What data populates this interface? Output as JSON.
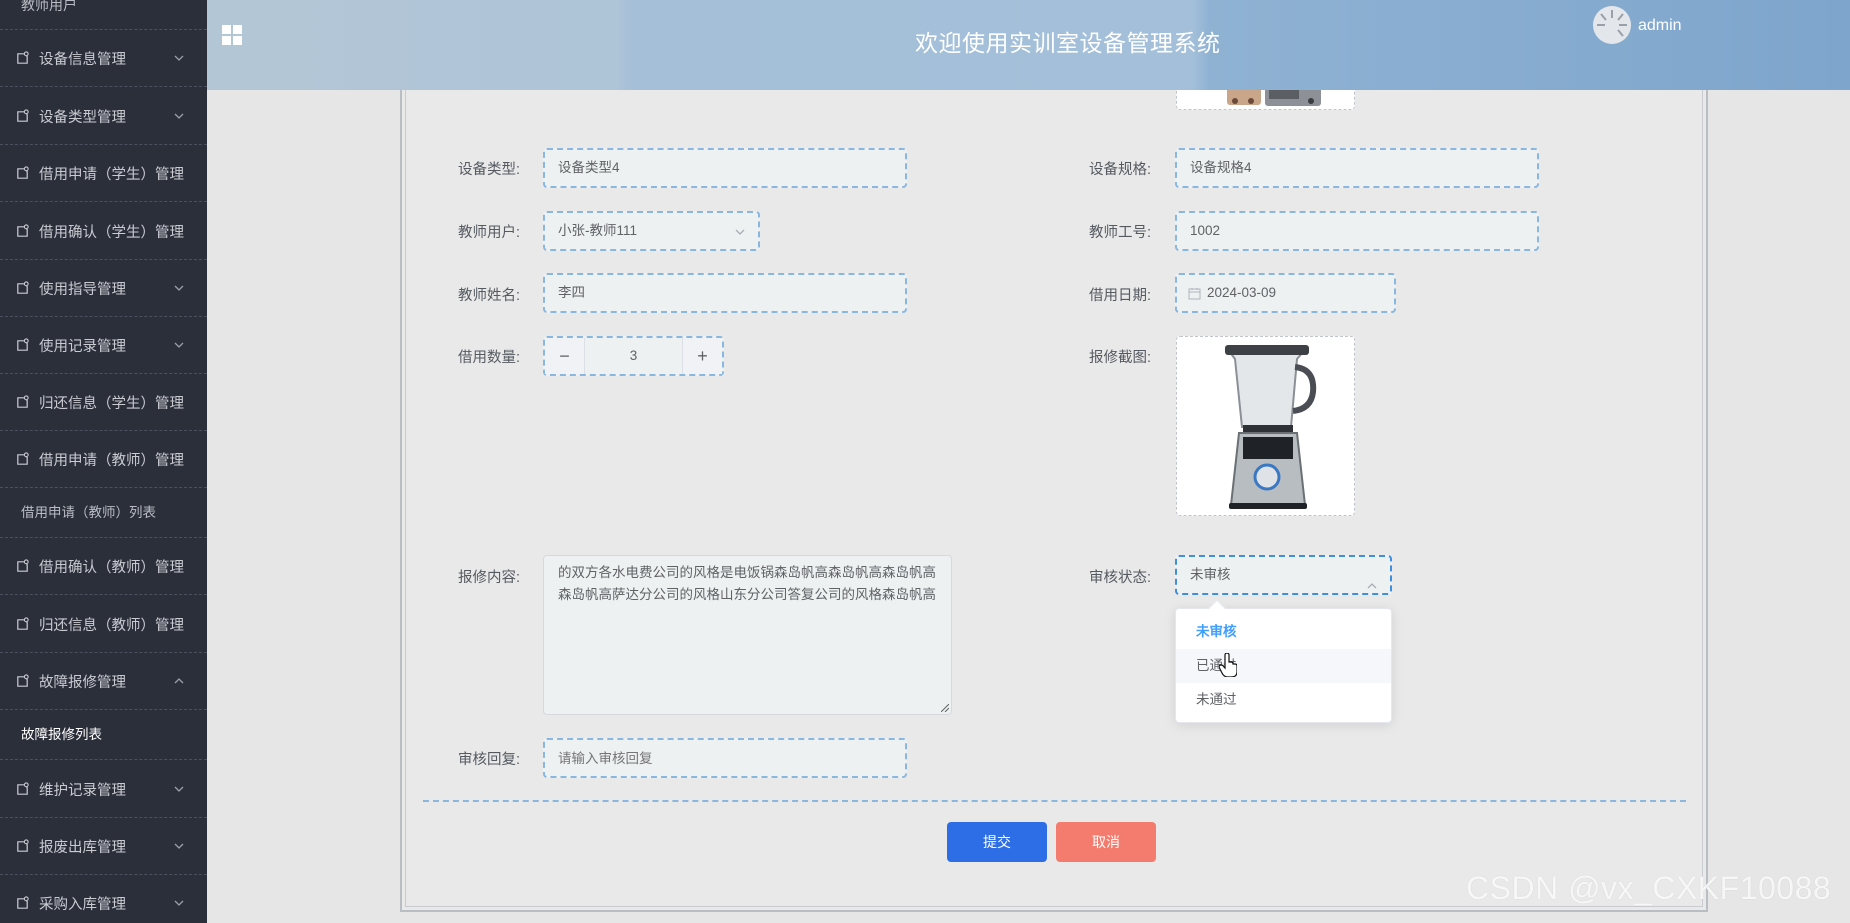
{
  "sidebar": {
    "top_sub": "教师用户",
    "items": [
      {
        "label": "设备信息管理"
      },
      {
        "label": "设备类型管理"
      },
      {
        "label": "借用申请（学生）管理"
      },
      {
        "label": "借用确认（学生）管理"
      },
      {
        "label": "使用指导管理"
      },
      {
        "label": "使用记录管理"
      },
      {
        "label": "归还信息（学生）管理"
      },
      {
        "label": "借用申请（教师）管理"
      },
      {
        "label": "借用确认（教师）管理"
      },
      {
        "label": "归还信息（教师）管理"
      },
      {
        "label": "故障报修管理"
      },
      {
        "label": "维护记录管理"
      },
      {
        "label": "报废出库管理"
      },
      {
        "label": "采购入库管理"
      }
    ],
    "sub_teacher_apply": "借用申请（教师）列表",
    "sub_fault_list": "故障报修列表"
  },
  "header": {
    "title": "欢迎使用实训室设备管理系统",
    "user": "admin"
  },
  "form": {
    "device_type": {
      "label": "设备类型:",
      "value": "设备类型4"
    },
    "device_spec": {
      "label": "设备规格:",
      "value": "设备规格4"
    },
    "teacher_user": {
      "label": "教师用户:",
      "value": "小张-教师111"
    },
    "teacher_no": {
      "label": "教师工号:",
      "value": "1002"
    },
    "teacher_name": {
      "label": "教师姓名:",
      "value": "李四"
    },
    "borrow_date": {
      "label": "借用日期:",
      "value": "2024-03-09"
    },
    "borrow_qty": {
      "label": "借用数量:",
      "value": "3"
    },
    "repair_image": {
      "label": "报修截图:"
    },
    "repair_content": {
      "label": "报修内容:",
      "value": "的双方各水电费公司的风格是电饭锅森岛帆高森岛帆高森岛帆高森岛帆高萨达分公司的风格山东分公司答复公司的风格森岛帆高"
    },
    "audit_status": {
      "label": "审核状态:",
      "value": "未审核"
    },
    "audit_reply": {
      "label": "审核回复:",
      "placeholder": "请输入审核回复"
    }
  },
  "dropdown": {
    "options": [
      "未审核",
      "已通过",
      "未通过"
    ]
  },
  "buttons": {
    "submit": "提交",
    "cancel": "取消"
  },
  "watermark": "CSDN @vx_CXKF10088"
}
